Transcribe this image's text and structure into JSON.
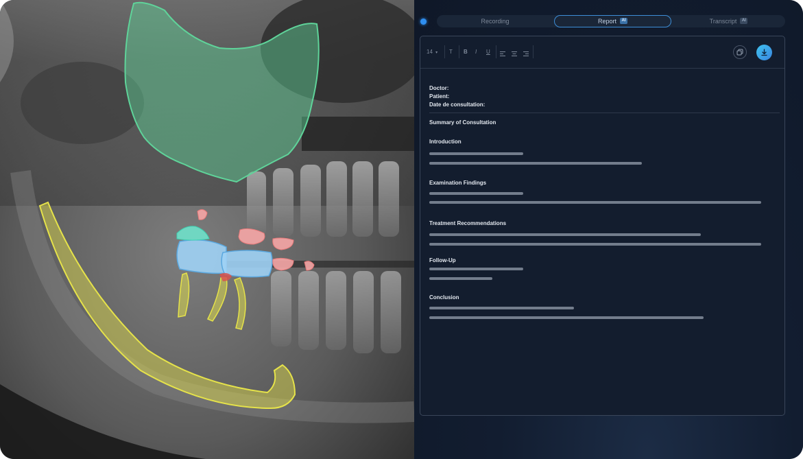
{
  "tabs": {
    "recording": "Recording",
    "report": "Report",
    "transcript": "Transcript",
    "ai_badge": "AI"
  },
  "toolbar": {
    "font_size": "14",
    "text_format_glyph": "T",
    "bold": "B",
    "italic": "I",
    "underline": "U"
  },
  "report": {
    "doctor_label": "Doctor:",
    "patient_label": "Patient:",
    "date_label": "Date de consultation:",
    "summary_title": "Summary of Consultation",
    "sections": [
      {
        "title": "Introduction"
      },
      {
        "title": "Examination Findings"
      },
      {
        "title": "Treatment Recommendations"
      },
      {
        "title": "Follow-Up"
      },
      {
        "title": "Conclusion"
      }
    ]
  },
  "colors": {
    "accent": "#3d8ed8",
    "sinus_overlay": "#5fd49a",
    "nerve_canal_overlay": "#e6e34a",
    "crown_overlay": "#9fd2f5",
    "caries_overlay": "#f6a6a6",
    "calculus_overlay": "#6ee8cf"
  },
  "icons": [
    "info-icon",
    "chevron-down-icon",
    "text-format-icon",
    "align-left-icon",
    "align-center-icon",
    "align-right-icon",
    "copy-icon",
    "download-icon"
  ]
}
